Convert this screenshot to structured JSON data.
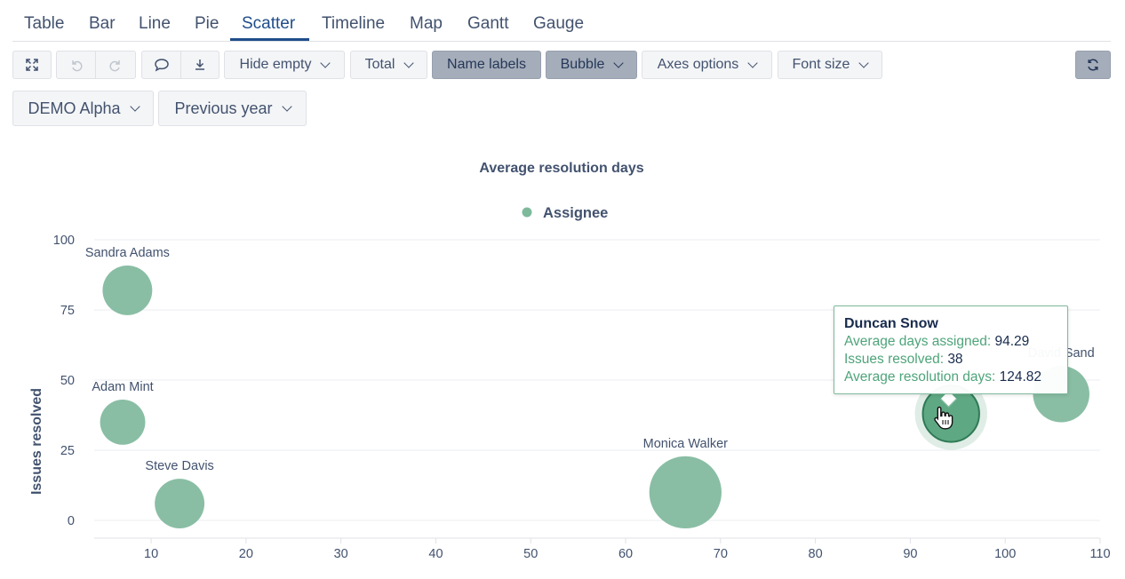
{
  "tabs": [
    {
      "label": "Table"
    },
    {
      "label": "Bar"
    },
    {
      "label": "Line"
    },
    {
      "label": "Pie"
    },
    {
      "label": "Scatter",
      "active": true
    },
    {
      "label": "Timeline"
    },
    {
      "label": "Map"
    },
    {
      "label": "Gantt"
    },
    {
      "label": "Gauge"
    }
  ],
  "toolbar": {
    "hide_empty": "Hide empty",
    "total": "Total",
    "name_labels": "Name labels",
    "bubble": "Bubble",
    "axes_options": "Axes options",
    "font_size": "Font size",
    "icons": [
      "expand-icon",
      "undo-icon",
      "redo-icon",
      "comment-icon",
      "download-icon",
      "refresh-icon"
    ]
  },
  "filters": {
    "project": "DEMO Alpha",
    "period": "Previous year"
  },
  "chart_data": {
    "type": "scatter",
    "title": "Average resolution days",
    "xlabel": "",
    "ylabel": "Issues resolved",
    "xlim": [
      4,
      110
    ],
    "ylim": [
      0,
      100
    ],
    "xticks": [
      10,
      20,
      30,
      40,
      50,
      60,
      70,
      80,
      90,
      100,
      110
    ],
    "yticks": [
      0,
      25,
      50,
      75,
      100
    ],
    "grid": true,
    "legend_position": "top-center",
    "color": "#7fb99c",
    "series": [
      {
        "name": "Assignee",
        "points": [
          {
            "label": "Sandra Adams",
            "x": 7.5,
            "y": 82,
            "size": 22
          },
          {
            "label": "Adam Mint",
            "x": 7,
            "y": 35,
            "size": 20
          },
          {
            "label": "Steve Davis",
            "x": 13,
            "y": 6,
            "size": 22
          },
          {
            "label": "Monica Walker",
            "x": 66.3,
            "y": 10,
            "size": 32
          },
          {
            "label": "Duncan Snow",
            "x": 94.29,
            "y": 38,
            "size": 24.96
          },
          {
            "label": "David Sand",
            "x": 105.9,
            "y": 45,
            "size": 25
          }
        ]
      }
    ]
  },
  "tooltip": {
    "title": "Duncan Snow",
    "rows": [
      {
        "key": "Average days assigned: ",
        "value": "94.29"
      },
      {
        "key": "Issues resolved: ",
        "value": "38"
      },
      {
        "key": "Average resolution days: ",
        "value": "124.82"
      }
    ]
  }
}
